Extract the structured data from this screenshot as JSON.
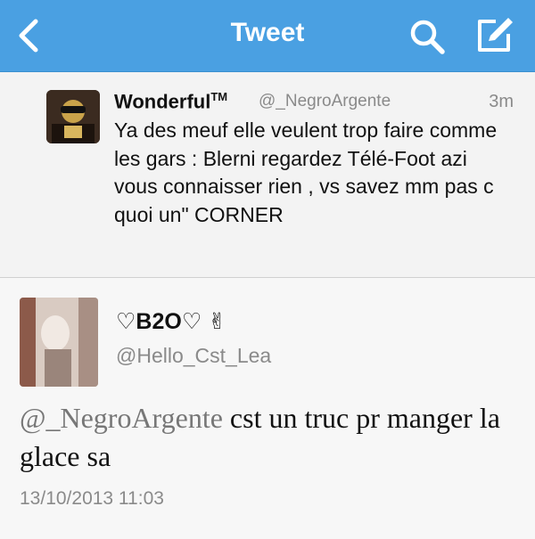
{
  "navbar": {
    "title": "Tweet",
    "back_icon": "chevron-left-icon",
    "search_icon": "search-icon",
    "compose_icon": "compose-icon",
    "background": "#4aa0e2"
  },
  "parent_tweet": {
    "display_name": "Wonderful",
    "display_name_suffix": "TM",
    "handle": "@_NegroArgente",
    "time": "3m",
    "text": "Ya des meuf elle veulent trop faire comme les gars : Blerni regardez Télé-Foot azi vous connaisser rien , vs savez mm pas c quoi un\" CORNER"
  },
  "reply_tweet": {
    "display_name": "♡B2O♡ ✌",
    "handle": "@Hello_Cst_Lea",
    "mention": "@_NegroArgente",
    "text": " cst un truc pr manger la glace sa",
    "date": "13/10/2013 11:03"
  }
}
